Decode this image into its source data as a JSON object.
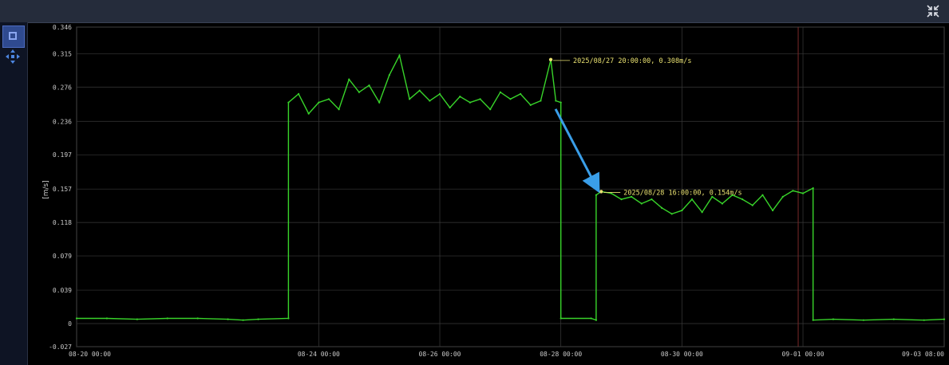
{
  "colors": {
    "background": "#000000",
    "grid": "#3a3a3a",
    "series": "#38d42a",
    "annotation": "#e8e070",
    "arrow": "#3a9ee8",
    "toolbar": "#252c3b",
    "marker_line": "#7a2a2a"
  },
  "icons": {
    "restore": "restore-window-icon",
    "select": "box-select-icon",
    "pan": "pan-arrows-icon"
  },
  "chart_data": {
    "type": "line",
    "title": "",
    "xlabel": "",
    "ylabel": "[m/s]",
    "grid": true,
    "legend": "none",
    "ylim": [
      -0.027,
      0.346
    ],
    "xlim": [
      "2025/08/20 00:00:00",
      "2025/09/03 08:00:00"
    ],
    "yticks": [
      "0.346",
      "0.315",
      "0.276",
      "0.236",
      "0.197",
      "0.157",
      "0.118",
      "0.079",
      "0.039",
      "0",
      "-0.027"
    ],
    "xticks": [
      {
        "t": "2025/08/20 00:00:00",
        "label": "08-20 00:00"
      },
      {
        "t": "2025/08/24 00:00:00",
        "label": "08-24 00:00"
      },
      {
        "t": "2025/08/26 00:00:00",
        "label": "08-26 00:00"
      },
      {
        "t": "2025/08/28 00:00:00",
        "label": "08-28 00:00"
      },
      {
        "t": "2025/08/30 00:00:00",
        "label": "08-30 00:00"
      },
      {
        "t": "2025/09/01 00:00:00",
        "label": "09-01 00:00"
      },
      {
        "t": "2025/09/03 08:00:00",
        "label": "09-03 08:00"
      }
    ],
    "vertical_marker": "2025/09/01 00:00:00",
    "series": [
      {
        "points": [
          [
            "2025/08/20 00:00:00",
            0.006
          ],
          [
            "2025/08/20 12:00:00",
            0.006
          ],
          [
            "2025/08/21 00:00:00",
            0.005
          ],
          [
            "2025/08/21 12:00:00",
            0.006
          ],
          [
            "2025/08/22 00:00:00",
            0.006
          ],
          [
            "2025/08/22 12:00:00",
            0.005
          ],
          [
            "2025/08/22 18:00:00",
            0.004
          ],
          [
            "2025/08/23 00:00:00",
            0.005
          ],
          [
            "2025/08/23 12:00:00",
            0.006
          ],
          [
            "2025/08/23 12:00:00",
            0.258
          ],
          [
            "2025/08/23 16:00:00",
            0.268
          ],
          [
            "2025/08/23 20:00:00",
            0.245
          ],
          [
            "2025/08/24 00:00:00",
            0.258
          ],
          [
            "2025/08/24 04:00:00",
            0.262
          ],
          [
            "2025/08/24 08:00:00",
            0.25
          ],
          [
            "2025/08/24 12:00:00",
            0.285
          ],
          [
            "2025/08/24 16:00:00",
            0.27
          ],
          [
            "2025/08/24 20:00:00",
            0.278
          ],
          [
            "2025/08/25 00:00:00",
            0.258
          ],
          [
            "2025/08/25 04:00:00",
            0.29
          ],
          [
            "2025/08/25 08:00:00",
            0.313
          ],
          [
            "2025/08/25 12:00:00",
            0.262
          ],
          [
            "2025/08/25 16:00:00",
            0.272
          ],
          [
            "2025/08/25 20:00:00",
            0.26
          ],
          [
            "2025/08/26 00:00:00",
            0.268
          ],
          [
            "2025/08/26 04:00:00",
            0.252
          ],
          [
            "2025/08/26 08:00:00",
            0.265
          ],
          [
            "2025/08/26 12:00:00",
            0.258
          ],
          [
            "2025/08/26 16:00:00",
            0.262
          ],
          [
            "2025/08/26 20:00:00",
            0.25
          ],
          [
            "2025/08/27 00:00:00",
            0.27
          ],
          [
            "2025/08/27 04:00:00",
            0.262
          ],
          [
            "2025/08/27 08:00:00",
            0.268
          ],
          [
            "2025/08/27 12:00:00",
            0.255
          ],
          [
            "2025/08/27 16:00:00",
            0.26
          ],
          [
            "2025/08/27 20:00:00",
            0.308
          ],
          [
            "2025/08/27 22:00:00",
            0.26
          ],
          [
            "2025/08/28 00:00:00",
            0.258
          ],
          [
            "2025/08/28 00:00:00",
            0.006
          ],
          [
            "2025/08/28 12:00:00",
            0.006
          ],
          [
            "2025/08/28 14:00:00",
            0.004
          ],
          [
            "2025/08/28 14:00:00",
            0.15
          ],
          [
            "2025/08/28 16:00:00",
            0.154
          ],
          [
            "2025/08/28 20:00:00",
            0.152
          ],
          [
            "2025/08/29 00:00:00",
            0.145
          ],
          [
            "2025/08/29 04:00:00",
            0.148
          ],
          [
            "2025/08/29 08:00:00",
            0.14
          ],
          [
            "2025/08/29 12:00:00",
            0.145
          ],
          [
            "2025/08/29 16:00:00",
            0.135
          ],
          [
            "2025/08/29 20:00:00",
            0.128
          ],
          [
            "2025/08/30 00:00:00",
            0.132
          ],
          [
            "2025/08/30 04:00:00",
            0.145
          ],
          [
            "2025/08/30 08:00:00",
            0.13
          ],
          [
            "2025/08/30 12:00:00",
            0.148
          ],
          [
            "2025/08/30 16:00:00",
            0.14
          ],
          [
            "2025/08/30 20:00:00",
            0.15
          ],
          [
            "2025/08/31 00:00:00",
            0.145
          ],
          [
            "2025/08/31 04:00:00",
            0.138
          ],
          [
            "2025/08/31 08:00:00",
            0.15
          ],
          [
            "2025/08/31 12:00:00",
            0.132
          ],
          [
            "2025/08/31 16:00:00",
            0.148
          ],
          [
            "2025/08/31 20:00:00",
            0.155
          ],
          [
            "2025/09/01 00:00:00",
            0.152
          ],
          [
            "2025/09/01 04:00:00",
            0.158
          ],
          [
            "2025/09/01 04:00:00",
            0.004
          ],
          [
            "2025/09/01 12:00:00",
            0.005
          ],
          [
            "2025/09/02 00:00:00",
            0.004
          ],
          [
            "2025/09/02 12:00:00",
            0.005
          ],
          [
            "2025/09/03 00:00:00",
            0.004
          ],
          [
            "2025/09/03 08:00:00",
            0.005
          ]
        ]
      }
    ],
    "annotations": [
      {
        "t": "2025/08/27 20:00:00",
        "y": 0.308,
        "text": "2025/08/27 20:00:00, 0.308m/s"
      },
      {
        "t": "2025/08/28 16:00:00",
        "y": 0.154,
        "text": "2025/08/28 16:00:00, 0.154m/s"
      }
    ]
  }
}
